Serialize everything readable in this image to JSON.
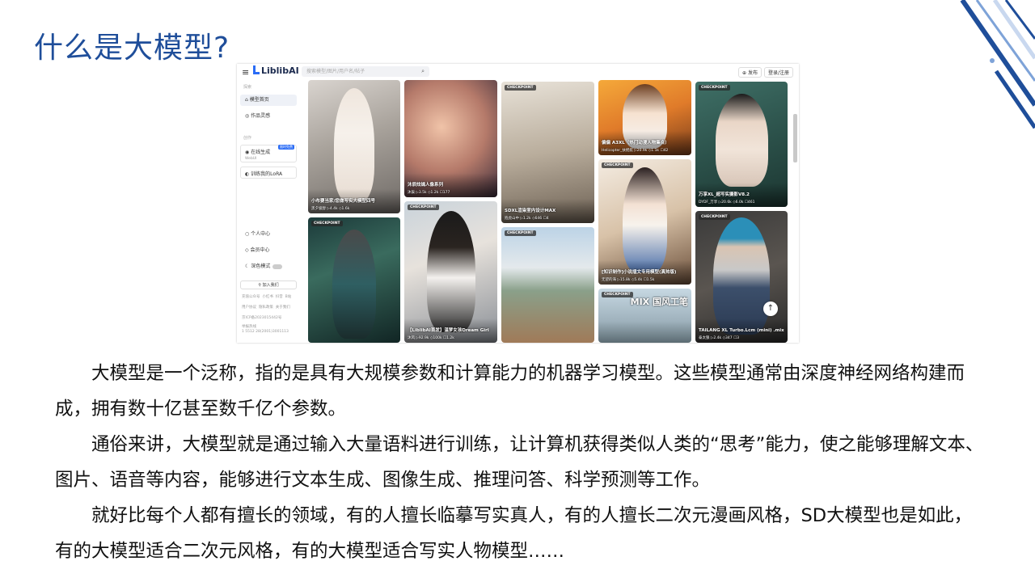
{
  "slide": {
    "title": "什么是大模型?",
    "paragraphs": [
      "大模型是一个泛称，指的是具有大规模参数和计算能力的机器学习模型。这些模型通常由深度神经网络构建而成，拥有数十亿甚至数千亿个参数。",
      "通俗来讲，大模型就是通过输入大量语料进行训练，让计算机获得类似人类的“思考”能力，使之能够理解文本、图片、语音等内容，能够进行文本生成、图像生成、推理问答、科学预测等工作。",
      "就好比每个人都有擅长的领域，有的人擅长临摹写实真人，有的人擅长二次元漫画风格，SD大模型也是如此，有的大模型适合二次元风格，有的大模型适合写实人物模型……"
    ],
    "accent_color": "#1f4e9a"
  },
  "screenshot": {
    "logo": "LiblibAI",
    "search_placeholder": "搜索模型/图片/用户名/帖子",
    "publish_label": "发布",
    "login_label": "登录/注册",
    "sidebar": {
      "group_explore": "探索",
      "items": [
        {
          "label": "模型首页",
          "icon": "home-icon"
        },
        {
          "label": "作品灵感",
          "icon": "bulb-icon"
        }
      ],
      "group_create": "创作",
      "online_gen": {
        "label": "在线生成",
        "sub": "WebUI",
        "tag": "限时免费"
      },
      "train": "训练我的LoRA",
      "personal": "个人中心",
      "member": "会员中心",
      "dark_mode": "深色模式",
      "join": "加入我们",
      "footer_links": [
        "充值公众号",
        "小红书",
        "抖音",
        "B站"
      ],
      "footer_links2": [
        "用户协议",
        "隐私政策",
        "关于我们"
      ],
      "icp": "京ICP备2023015442号",
      "hotline": "举报热线",
      "phone": "1 5512 28(2001)3001113"
    },
    "cards": [
      {
        "title": "小布要当家/您做写实大模型四号",
        "stats": "黑夕极醇 ▷4.4k ◇1.6k"
      },
      {
        "badge": "CHECKPOINT",
        "title": "",
        "stats": ""
      },
      {
        "title": "沐辰炫嫣人像系列",
        "stats": "沐辰 ▷3.5k ◇1.2k ☐177"
      },
      {
        "badge": "CHECKPOINT",
        "title": "【LiblibAI首发】温梦女孩Dream Girl",
        "stats": "沐风 ▷92.9k ◇100k ☐1.2k"
      },
      {
        "badge": "CHECKPOINT",
        "title": "SDXL渲染室内设计MAX",
        "stats": "抱虎山中 ▷1.2k ◇646 ☐4"
      },
      {
        "badge": "CHECKPOINT",
        "title": "",
        "stats": ""
      },
      {
        "title": "偏偏 A3XL（热门动漫人物集合）",
        "stats": "Helicopter_扶摇航 ▷20.9k ◇1.1k ☐42"
      },
      {
        "badge": "CHECKPOINT",
        "title": "[知识制作]小说插文专用模型(真帅版)",
        "stats": "无望的海 ▷15.8k ◇5.4k ☐1.5k"
      },
      {
        "badge": "CHECKPOINT",
        "title": "MIX 国风工笔",
        "stats": ""
      },
      {
        "badge": "CHECKPOINT",
        "title": "万享XL_超写实摄影V8.2",
        "stats": "DYDF_万享 ▷20.6k ◇6.0k ☐461"
      },
      {
        "badge": "CHECKPOINT",
        "title": "TAILANG XL Turbo.Lcm (mini) .mix",
        "stats": "泰太狼 ▷2.4k ◇347 ☐3"
      }
    ]
  }
}
